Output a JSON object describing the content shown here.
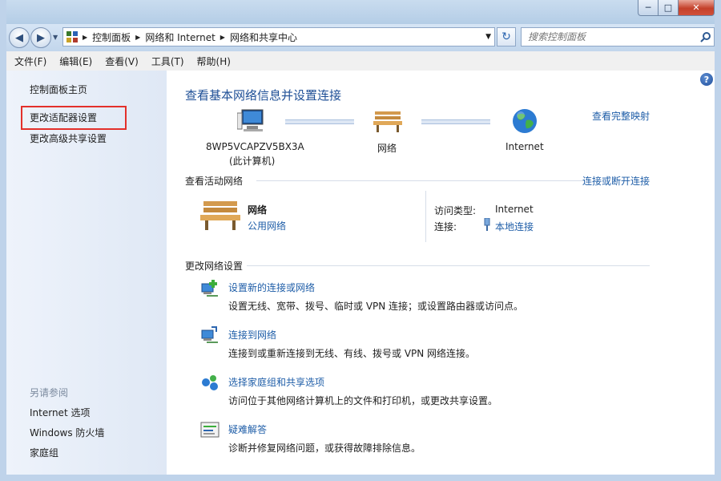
{
  "address": {
    "crumbs": [
      "控制面板",
      "网络和 Internet",
      "网络和共享中心"
    ],
    "search_placeholder": "搜索控制面板"
  },
  "menubar": [
    "文件(F)",
    "编辑(E)",
    "查看(V)",
    "工具(T)",
    "帮助(H)"
  ],
  "sidebar": {
    "home": "控制面板主页",
    "adapter": "更改适配器设置",
    "advanced_sharing": "更改高级共享设置",
    "see_also_title": "另请参阅",
    "see_also": [
      "Internet 选项",
      "Windows 防火墙",
      "家庭组"
    ]
  },
  "main": {
    "title": "查看基本网络信息并设置连接",
    "full_map": "查看完整映射",
    "map": {
      "computer_name": "8WP5VCAPZV5BX3A",
      "computer_sub": "(此计算机)",
      "network": "网络",
      "internet": "Internet"
    },
    "active": {
      "heading": "查看活动网络",
      "connect_link": "连接或断开连接",
      "network_name": "网络",
      "network_type": "公用网络",
      "access_label": "访问类型:",
      "access_value": "Internet",
      "conn_label": "连接:",
      "conn_value": "本地连接"
    },
    "settings": {
      "heading": "更改网络设置",
      "tasks": [
        {
          "title": "设置新的连接或网络",
          "desc": "设置无线、宽带、拨号、临时或 VPN 连接；或设置路由器或访问点。"
        },
        {
          "title": "连接到网络",
          "desc": "连接到或重新连接到无线、有线、拨号或 VPN 网络连接。"
        },
        {
          "title": "选择家庭组和共享选项",
          "desc": "访问位于其他网络计算机上的文件和打印机，或更改共享设置。"
        },
        {
          "title": "疑难解答",
          "desc": "诊断并修复网络问题，或获得故障排除信息。"
        }
      ]
    }
  },
  "colors": {
    "accent_link": "#1f5ea8",
    "highlight_box": "#e3302b",
    "title_blue": "#1e4f96"
  }
}
